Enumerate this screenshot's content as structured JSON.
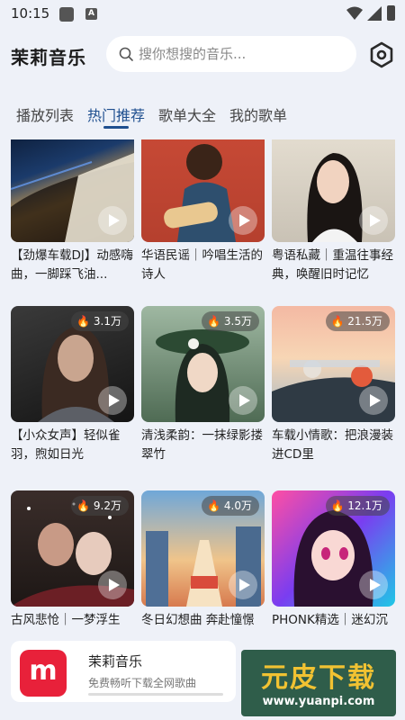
{
  "status_bar": {
    "time": "10:15",
    "badge": "A"
  },
  "header": {
    "title": "茉莉音乐",
    "search_placeholder": "搜你想搜的音乐..."
  },
  "tabs": [
    {
      "label": "播放列表",
      "active": false
    },
    {
      "label": "热门推荐",
      "active": true
    },
    {
      "label": "歌单大全",
      "active": false
    },
    {
      "label": "我的歌单",
      "active": false
    }
  ],
  "playlists": [
    {
      "title": "【劲爆车载DJ】动感嗨曲，一脚踩飞油...",
      "plays": "",
      "icon": "play-icon"
    },
    {
      "title": "华语民谣｜吟唱生活的诗人",
      "plays": "",
      "icon": "play-icon"
    },
    {
      "title": "粤语私藏｜重温往事经典，唤醒旧时记忆",
      "plays": "",
      "icon": "play-icon"
    },
    {
      "title": "【小众女声】轻似雀羽，煦如日光",
      "plays": "3.1万",
      "icon": "play-icon"
    },
    {
      "title": "清浅柔韵：一抹绿影搂翠竹",
      "plays": "3.5万",
      "icon": "play-icon"
    },
    {
      "title": "车载小情歌：把浪漫装进CD里",
      "plays": "21.5万",
      "icon": "play-icon"
    },
    {
      "title": "古风悲怆｜一梦浮生",
      "plays": "9.2万",
      "icon": "play-icon"
    },
    {
      "title": "冬日幻想曲 奔赴憧憬",
      "plays": "4.0万",
      "icon": "play-icon"
    },
    {
      "title": "PHONK精选｜迷幻沉",
      "plays": "12.1万",
      "icon": "play-icon"
    }
  ],
  "promo": {
    "logo_text": "m",
    "name": "茉莉音乐",
    "subtitle": "免费畅听下载全网歌曲"
  },
  "watermark": {
    "text": "元皮下载",
    "url": "www.yuanpi.com"
  },
  "colors": {
    "accent": "#1f4f8f",
    "logo": "#e8213a",
    "background": "#eef1f8"
  }
}
